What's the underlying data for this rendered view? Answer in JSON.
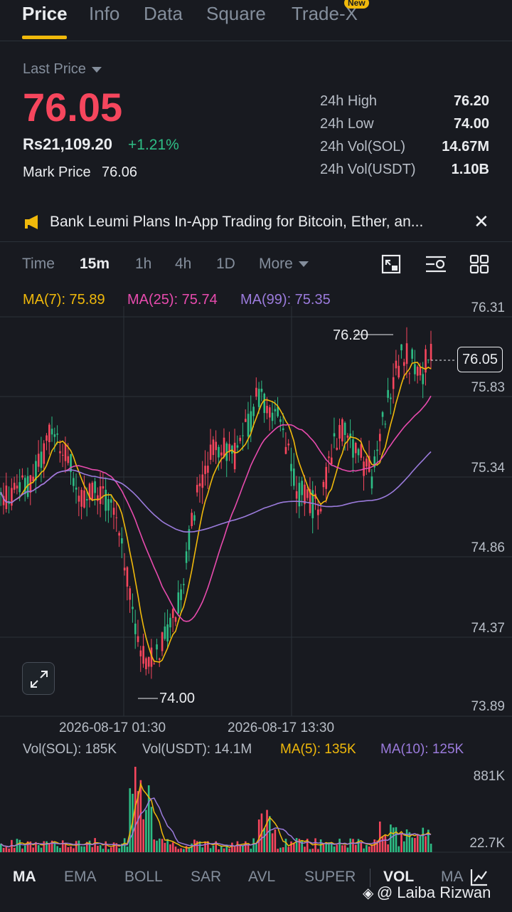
{
  "tabs": [
    {
      "label": "Price"
    },
    {
      "label": "Info"
    },
    {
      "label": "Data"
    },
    {
      "label": "Square"
    },
    {
      "label": "Trade-X"
    }
  ],
  "new_badge": "New",
  "ticker": {
    "last_price_label": "Last Price",
    "last_price": "76.05",
    "fiat_price": "Rs21,109.20",
    "change_pct": "+1.21%",
    "mark_price_label": "Mark Price",
    "mark_price": "76.06"
  },
  "stats": [
    {
      "label": "24h High",
      "value": "76.20"
    },
    {
      "label": "24h Low",
      "value": "74.00"
    },
    {
      "label": "24h Vol(SOL)",
      "value": "14.67M"
    },
    {
      "label": "24h Vol(USDT)",
      "value": "1.10B"
    }
  ],
  "news": {
    "text": "Bank Leumi Plans In-App Trading for Bitcoin, Ether, an..."
  },
  "intervals": [
    {
      "label": "Time"
    },
    {
      "label": "15m"
    },
    {
      "label": "1h"
    },
    {
      "label": "4h"
    },
    {
      "label": "1D"
    },
    {
      "label": "More"
    }
  ],
  "ma_legend": [
    {
      "label": "MA(7): 75.89",
      "color": "#f0b90b"
    },
    {
      "label": "MA(25): 75.74",
      "color": "#e84bae"
    },
    {
      "label": "MA(99): 75.35",
      "color": "#9b7bdc"
    }
  ],
  "price_axis": [
    "76.31",
    "75.83",
    "75.34",
    "74.86",
    "74.37",
    "73.89"
  ],
  "high_marker": "76.20",
  "low_marker": "74.00",
  "current_price_box": "76.05",
  "time_axis": [
    "2026-08-17 01:30",
    "2026-08-17 13:30"
  ],
  "vol_legend": [
    {
      "label": "Vol(SOL): 185K",
      "color": "#b7bdc6"
    },
    {
      "label": "Vol(USDT): 14.1M",
      "color": "#b7bdc6"
    },
    {
      "label": "MA(5): 135K",
      "color": "#f0b90b"
    },
    {
      "label": "MA(10): 125K",
      "color": "#9b7bdc"
    }
  ],
  "vol_axis": [
    "881K",
    "22.7K"
  ],
  "indicators": [
    {
      "label": "MA"
    },
    {
      "label": "EMA"
    },
    {
      "label": "BOLL"
    },
    {
      "label": "SAR"
    },
    {
      "label": "AVL"
    },
    {
      "label": "SUPER"
    },
    {
      "label": "VOL"
    },
    {
      "label": "MA"
    }
  ],
  "watermark": "@ Laiba Rizwan",
  "colors": {
    "up": "#2ebd85",
    "down": "#f6465d",
    "accent": "#f0b90b"
  },
  "chart_data": {
    "type": "candlestick",
    "y_range": [
      73.89,
      76.31
    ],
    "seed": 7
  }
}
